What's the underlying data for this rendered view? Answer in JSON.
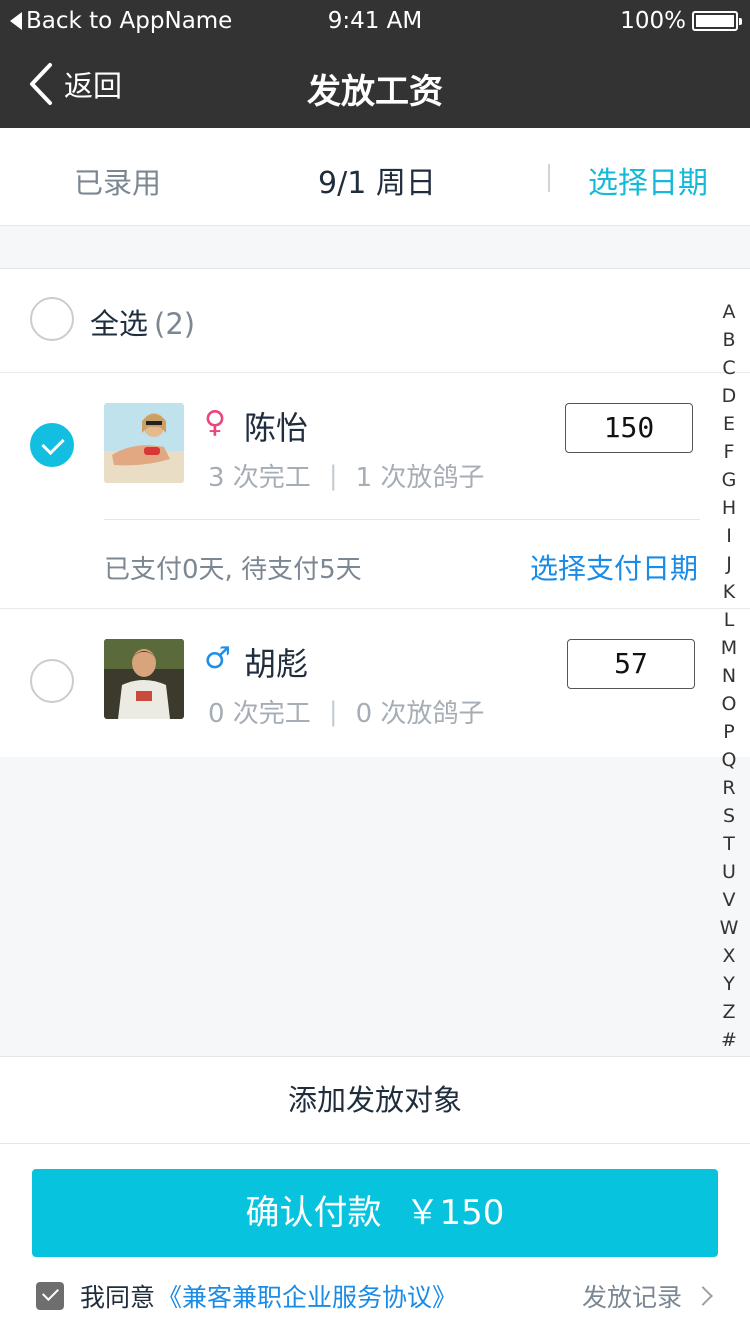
{
  "status_bar": {
    "back_to_app": "Back to AppName",
    "time": "9:41 AM",
    "battery": "100%"
  },
  "nav": {
    "back_label": "返回",
    "title": "发放工资"
  },
  "date_bar": {
    "hired_label": "已录用",
    "current_date": "9/1 周日",
    "pick_date": "选择日期"
  },
  "select_all": {
    "label": "全选",
    "count": "(2)",
    "checked": false
  },
  "people": [
    {
      "name": "陈怡",
      "gender_symbol": "♀",
      "completed": "3 次完工",
      "no_show": "1 次放鸽子",
      "amount": "150",
      "checked": true,
      "pay_status": "已支付0天, 待支付5天",
      "pay_date_link": "选择支付日期"
    },
    {
      "name": "胡彪",
      "gender_symbol": "♂",
      "completed": "0 次完工",
      "no_show": "0 次放鸽子",
      "amount": "57",
      "checked": false
    }
  ],
  "alphabet_index": [
    "A",
    "B",
    "C",
    "D",
    "E",
    "F",
    "G",
    "H",
    "I",
    "J",
    "K",
    "L",
    "M",
    "N",
    "O",
    "P",
    "Q",
    "R",
    "S",
    "T",
    "U",
    "V",
    "W",
    "X",
    "Y",
    "Z",
    "#"
  ],
  "add_target": "添加发放对象",
  "footer": {
    "confirm_label": "确认付款",
    "confirm_amount": "￥150",
    "agree_prefix": "我同意",
    "agreement_link": "《兼客兼职企业服务协议》",
    "record_link": "发放记录"
  },
  "colors": {
    "accent": "#08c3de",
    "link_blue": "#1a8be6",
    "nav_bg": "#333333",
    "female": "#e8467c",
    "male": "#1e8fe8"
  }
}
